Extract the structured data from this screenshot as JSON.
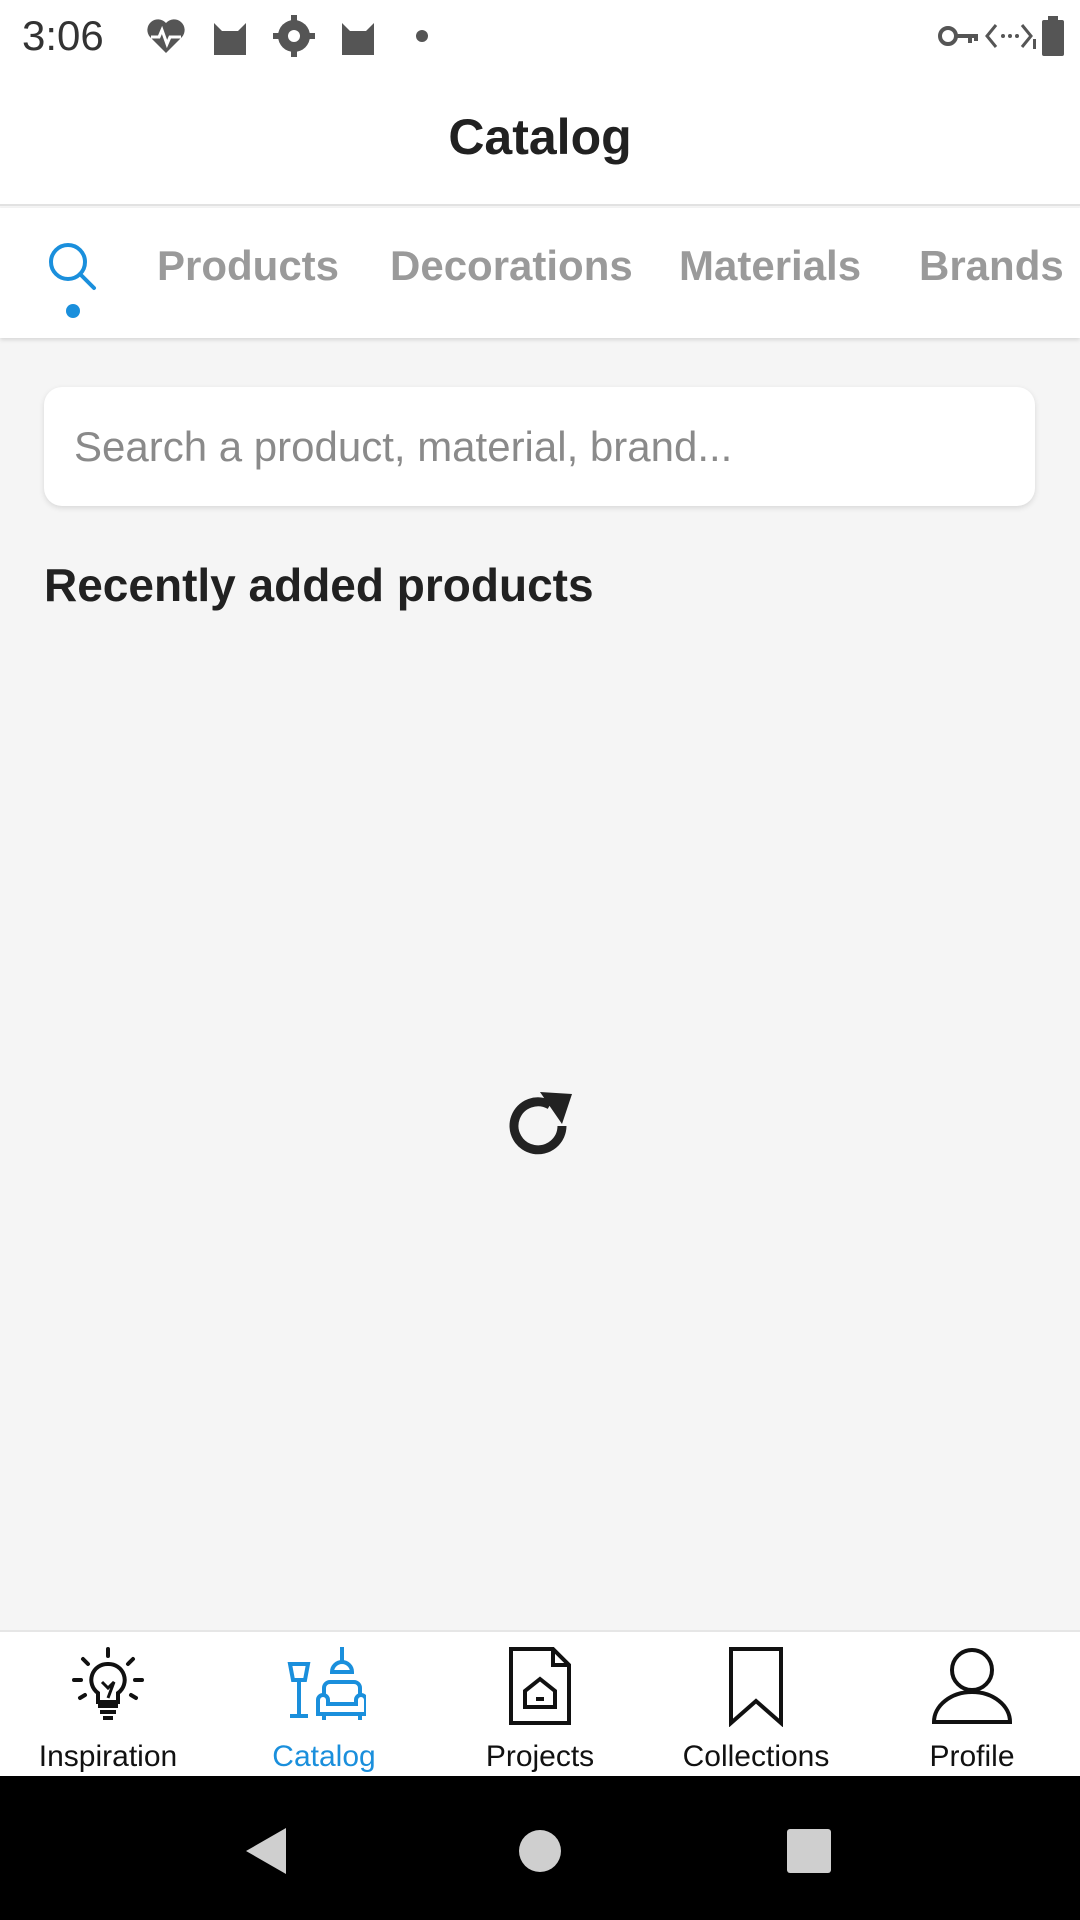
{
  "status_bar": {
    "time": "3:06",
    "left_icons": [
      "heart-pulse-icon",
      "cat-icon",
      "gear-badge-icon",
      "cat-icon",
      "dot-icon"
    ],
    "right_icons": [
      "key-icon",
      "code-arrows-icon",
      "battery-icon"
    ]
  },
  "app_bar": {
    "title": "Catalog"
  },
  "tabs": {
    "search_icon": "search-icon",
    "items": [
      {
        "label": "Products"
      },
      {
        "label": "Decorations"
      },
      {
        "label": "Materials"
      },
      {
        "label": "Brands"
      }
    ],
    "active_color": "#1a8fdc",
    "inactive_color": "#9a9a9a"
  },
  "search": {
    "placeholder": "Search a product, material, brand..."
  },
  "main": {
    "section_title": "Recently added products",
    "loading_icon": "refresh-icon"
  },
  "bottom_nav": {
    "active_index": 1,
    "items": [
      {
        "label": "Inspiration",
        "icon": "lightbulb-icon"
      },
      {
        "label": "Catalog",
        "icon": "lamp-sofa-icon"
      },
      {
        "label": "Projects",
        "icon": "house-document-icon"
      },
      {
        "label": "Collections",
        "icon": "bookmark-icon"
      },
      {
        "label": "Profile",
        "icon": "person-icon"
      }
    ]
  },
  "system_nav": {
    "buttons": [
      "back-icon",
      "home-icon",
      "recents-icon"
    ]
  }
}
